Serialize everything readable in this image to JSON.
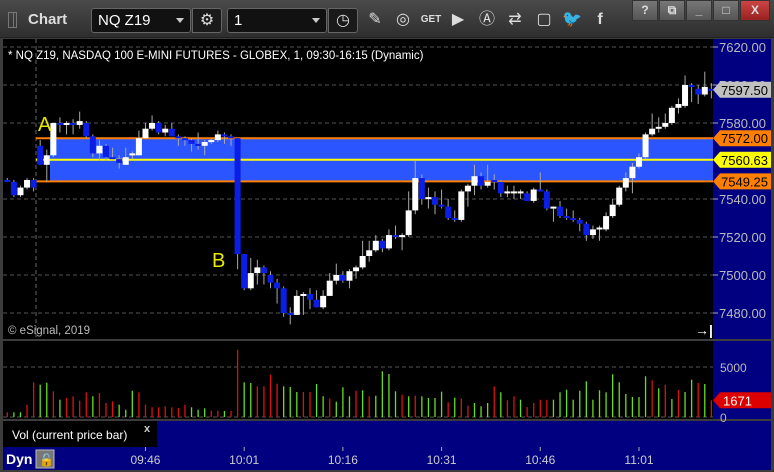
{
  "window": {
    "title": "Chart",
    "symbol": "NQ Z19",
    "interval": "1",
    "buttons": {
      "help": "?",
      "restore": "⧉",
      "minimize": "_",
      "maximize": "□",
      "close": "X"
    },
    "toolbar_icons": [
      "settings-gear-icon",
      "clock-icon",
      "pencil-icon",
      "study-icon",
      "get-icon",
      "play-icon",
      "alert-icon",
      "link-icon",
      "comment-icon",
      "twitter-icon",
      "facebook-icon"
    ]
  },
  "chart": {
    "header": "* NQ Z19, NASDAQ 100 E-MINI FUTURES - GLOBEX, 1, 09:30-16:15 (Dynamic)",
    "copyright": "© eSignal, 2019",
    "annotations": [
      {
        "text": "A"
      },
      {
        "text": "B"
      }
    ],
    "price_axis": [
      "7620.00",
      "7600.00",
      "7580.00",
      "7540.00",
      "7520.00",
      "7500.00",
      "7480.00"
    ],
    "price_ticks": [
      7620,
      7600,
      7580,
      7540,
      7520,
      7500,
      7480
    ],
    "last_price": {
      "label": "7597.50",
      "value": 7597.5,
      "color": "#c0c0c0"
    },
    "levels": [
      {
        "label": "7572.00",
        "value": 7572.0,
        "color": "#ff8000"
      },
      {
        "label": "7560.63",
        "value": 7560.63,
        "color": "#ffff00"
      },
      {
        "label": "7549.25",
        "value": 7549.25,
        "color": "#ff8000"
      }
    ],
    "zone_color": "#2a55ff",
    "up_color": "#ffffff",
    "down_color": "#0a1ee6",
    "time_axis": [
      "09:46",
      "10:01",
      "10:16",
      "10:31",
      "10:46",
      "11:01"
    ]
  },
  "chart_data": {
    "type": "candlestick",
    "interval_minutes": 1,
    "ohlc": [
      [
        7550,
        7551,
        7549,
        7549.5
      ],
      [
        7549,
        7550,
        7541,
        7542
      ],
      [
        7542,
        7547,
        7541,
        7546
      ],
      [
        7546,
        7551,
        7545,
        7550
      ],
      [
        7550,
        7551,
        7544,
        7546
      ],
      [
        7568,
        7571,
        7558,
        7558
      ],
      [
        7558,
        7566,
        7549,
        7563
      ],
      [
        7563,
        7580,
        7562,
        7580
      ],
      [
        7580,
        7583,
        7575,
        7579
      ],
      [
        7579,
        7581,
        7574,
        7580
      ],
      [
        7580,
        7582,
        7574,
        7579
      ],
      [
        7579,
        7586,
        7577,
        7581
      ],
      [
        7580,
        7581,
        7572,
        7573
      ],
      [
        7573,
        7574,
        7562,
        7564
      ],
      [
        7564,
        7571,
        7560,
        7568
      ],
      [
        7568,
        7569,
        7560,
        7562
      ],
      [
        7562,
        7567,
        7561,
        7561
      ],
      [
        7561,
        7563,
        7556,
        7559
      ],
      [
        7558,
        7567,
        7558,
        7562
      ],
      [
        7563,
        7565,
        7561,
        7564
      ],
      [
        7563,
        7576,
        7563,
        7572
      ],
      [
        7572,
        7580,
        7572,
        7577
      ],
      [
        7577,
        7584,
        7576,
        7580
      ],
      [
        7580,
        7581,
        7574,
        7575
      ],
      [
        7575,
        7579,
        7573,
        7577
      ],
      [
        7577,
        7580,
        7573,
        7573
      ],
      [
        7573,
        7574,
        7568,
        7572
      ],
      [
        7572,
        7573,
        7568,
        7571
      ],
      [
        7571,
        7572,
        7565,
        7569
      ],
      [
        7569,
        7575,
        7566,
        7568
      ],
      [
        7568,
        7571,
        7563,
        7570
      ],
      [
        7570,
        7572,
        7569,
        7571
      ],
      [
        7571,
        7576,
        7570,
        7574
      ],
      [
        7574,
        7575,
        7569,
        7573
      ],
      [
        7573,
        7574,
        7568,
        7572
      ],
      [
        7572,
        7572,
        7503,
        7511
      ],
      [
        7511,
        7511,
        7492,
        7493
      ],
      [
        7493,
        7509,
        7492,
        7501
      ],
      [
        7501,
        7508,
        7495,
        7504
      ],
      [
        7504,
        7505,
        7495,
        7501
      ],
      [
        7500,
        7502,
        7493,
        7496
      ],
      [
        7496,
        7498,
        7485,
        7493
      ],
      [
        7493,
        7494,
        7478,
        7480
      ],
      [
        7480,
        7483,
        7474,
        7479
      ],
      [
        7479,
        7492,
        7479,
        7489
      ],
      [
        7489,
        7491,
        7479,
        7490
      ],
      [
        7490,
        7493,
        7482,
        7487
      ],
      [
        7487,
        7492,
        7483,
        7483
      ],
      [
        7483,
        7492,
        7482,
        7489
      ],
      [
        7489,
        7501,
        7489,
        7497
      ],
      [
        7497,
        7506,
        7495,
        7500
      ],
      [
        7500,
        7502,
        7496,
        7497
      ],
      [
        7497,
        7503,
        7493,
        7502
      ],
      [
        7502,
        7505,
        7498,
        7504
      ],
      [
        7504,
        7518,
        7503,
        7510
      ],
      [
        7510,
        7518,
        7507,
        7513
      ],
      [
        7513,
        7521,
        7512,
        7518
      ],
      [
        7518,
        7519,
        7512,
        7514
      ],
      [
        7514,
        7524,
        7513,
        7521
      ],
      [
        7521,
        7526,
        7519,
        7520
      ],
      [
        7520,
        7522,
        7513,
        7521
      ],
      [
        7521,
        7544,
        7520,
        7534
      ],
      [
        7534,
        7560,
        7532,
        7551
      ],
      [
        7551,
        7553,
        7537,
        7540
      ],
      [
        7540,
        7546,
        7535,
        7541
      ],
      [
        7541,
        7544,
        7532,
        7537
      ],
      [
        7537,
        7545,
        7535,
        7536
      ],
      [
        7536,
        7540,
        7529,
        7530
      ],
      [
        7530,
        7534,
        7528,
        7529
      ],
      [
        7529,
        7545,
        7528,
        7544
      ],
      [
        7544,
        7548,
        7536,
        7547
      ],
      [
        7547,
        7558,
        7542,
        7552
      ],
      [
        7552,
        7554,
        7545,
        7547
      ],
      [
        7547,
        7558,
        7546,
        7549
      ],
      [
        7550,
        7553,
        7545,
        7549
      ],
      [
        7549,
        7550,
        7541,
        7543
      ],
      [
        7543,
        7547,
        7541,
        7544
      ],
      [
        7543,
        7547,
        7540,
        7544
      ],
      [
        7543,
        7545,
        7540,
        7544
      ],
      [
        7543,
        7544,
        7539,
        7539
      ],
      [
        7539,
        7546,
        7538,
        7545
      ],
      [
        7545,
        7554,
        7544,
        7544
      ],
      [
        7544,
        7545,
        7534,
        7535
      ],
      [
        7535,
        7536,
        7528,
        7536
      ],
      [
        7536,
        7539,
        7530,
        7531
      ],
      [
        7531,
        7535,
        7529,
        7530
      ],
      [
        7530,
        7534,
        7528,
        7529
      ],
      [
        7529,
        7530,
        7523,
        7527
      ],
      [
        7527,
        7528,
        7518,
        7521
      ],
      [
        7521,
        7526,
        7519,
        7524
      ],
      [
        7524,
        7526,
        7518,
        7525
      ],
      [
        7524,
        7533,
        7523,
        7531
      ],
      [
        7531,
        7540,
        7530,
        7537
      ],
      [
        7537,
        7547,
        7536,
        7546
      ],
      [
        7546,
        7554,
        7544,
        7551
      ],
      [
        7551,
        7559,
        7543,
        7557
      ],
      [
        7557,
        7564,
        7556,
        7562
      ],
      [
        7562,
        7575,
        7561,
        7574
      ],
      [
        7574,
        7585,
        7573,
        7577
      ],
      [
        7577,
        7583,
        7575,
        7578
      ],
      [
        7578,
        7585,
        7577,
        7580
      ],
      [
        7580,
        7589,
        7579,
        7588
      ],
      [
        7588,
        7593,
        7585,
        7590
      ],
      [
        7589,
        7605,
        7588,
        7600
      ],
      [
        7600,
        7601,
        7591,
        7599
      ],
      [
        7598,
        7600,
        7590,
        7595
      ],
      [
        7595,
        7607,
        7594,
        7599
      ],
      [
        7598,
        7601,
        7593,
        7597.5
      ]
    ],
    "volume": {
      "axis_labels": [
        "5000",
        "0"
      ],
      "axis_ticks": [
        5000,
        0
      ],
      "current": {
        "label": "1671",
        "value": 1671,
        "color": "#dd0000"
      },
      "values": [
        470,
        470,
        470,
        1230,
        3470,
        3230,
        3430,
        2570,
        1730,
        1900,
        2070,
        1630,
        2470,
        2070,
        2400,
        1400,
        1570,
        1230,
        730,
        2630,
        2470,
        1230,
        970,
        970,
        1070,
        970,
        900,
        1230,
        970,
        730,
        870,
        630,
        630,
        600,
        600,
        6730,
        3470,
        3400,
        3070,
        3070,
        4230,
        3330,
        3070,
        3000,
        2500,
        2500,
        2500,
        3300,
        2070,
        1830,
        1530,
        2970,
        2070,
        2630,
        2670,
        2070,
        2130,
        4570,
        4300,
        2570,
        2230,
        2070,
        2130,
        2070,
        1900,
        1900,
        2530,
        1470,
        1930,
        1830,
        1130,
        1400,
        1070,
        1400,
        3070,
        2470,
        1670,
        2070,
        1730,
        1000,
        1400,
        1730,
        1730,
        1730,
        2470,
        2730,
        1730,
        2630,
        3570,
        1730,
        2670,
        2470,
        4270,
        3470,
        2300,
        2000,
        2000,
        4070,
        3670,
        2870,
        3230,
        1800,
        2700,
        2500,
        3730,
        3400,
        3300,
        1671
      ],
      "colors": "rggrrggrgrrrrgrrrgggrrrrrrrrgggrrgrrggrrrrgggrrggrgggrgrggggrgrggggrgrrgggrgrrgrrrrgggggggggggggggrgrgrggrgrr",
      "label": "Vol (current price bar)",
      "close": "x"
    }
  },
  "footer": {
    "dynamic_label": "Dyn"
  }
}
